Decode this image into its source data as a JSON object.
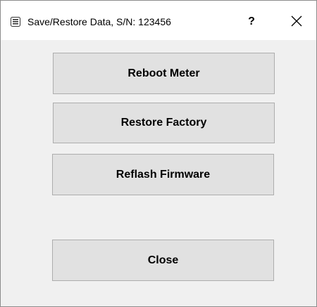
{
  "window": {
    "title": "Save/Restore Data, S/N: 123456",
    "help_label": "?",
    "icon": "app-window-icon",
    "close_icon": "close-icon"
  },
  "buttons": {
    "reboot_label": "Reboot Meter",
    "restore_label": "Restore Factory",
    "reflash_label": "Reflash Firmware",
    "close_label": "Close"
  }
}
